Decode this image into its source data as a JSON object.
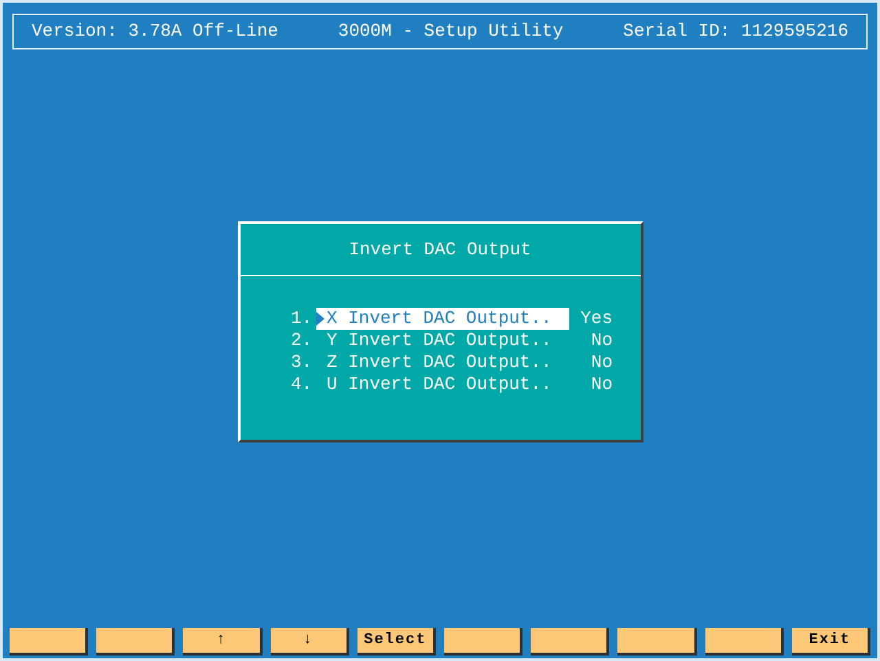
{
  "header": {
    "version": "Version: 3.78A Off-Line",
    "title": "3000M - Setup Utility",
    "serial": "Serial ID: 1129595216"
  },
  "dialog": {
    "title": "Invert DAC Output",
    "items": [
      {
        "number": "1.",
        "label": "X Invert DAC Output..",
        "value": "Yes",
        "selected": true
      },
      {
        "number": "2.",
        "label": "Y Invert DAC Output..",
        "value": "No",
        "selected": false
      },
      {
        "number": "3.",
        "label": "Z Invert DAC Output..",
        "value": "No",
        "selected": false
      },
      {
        "number": "4.",
        "label": "U Invert DAC Output..",
        "value": "No",
        "selected": false
      }
    ]
  },
  "function_keys": [
    {
      "kind": "blank"
    },
    {
      "kind": "blank"
    },
    {
      "kind": "labeled",
      "label": "↑"
    },
    {
      "kind": "labeled",
      "label": "↓"
    },
    {
      "kind": "labeled",
      "label": "Select"
    },
    {
      "kind": "blank"
    },
    {
      "kind": "blank"
    },
    {
      "kind": "blank"
    },
    {
      "kind": "blank"
    },
    {
      "kind": "labeled",
      "label": "Exit"
    }
  ]
}
